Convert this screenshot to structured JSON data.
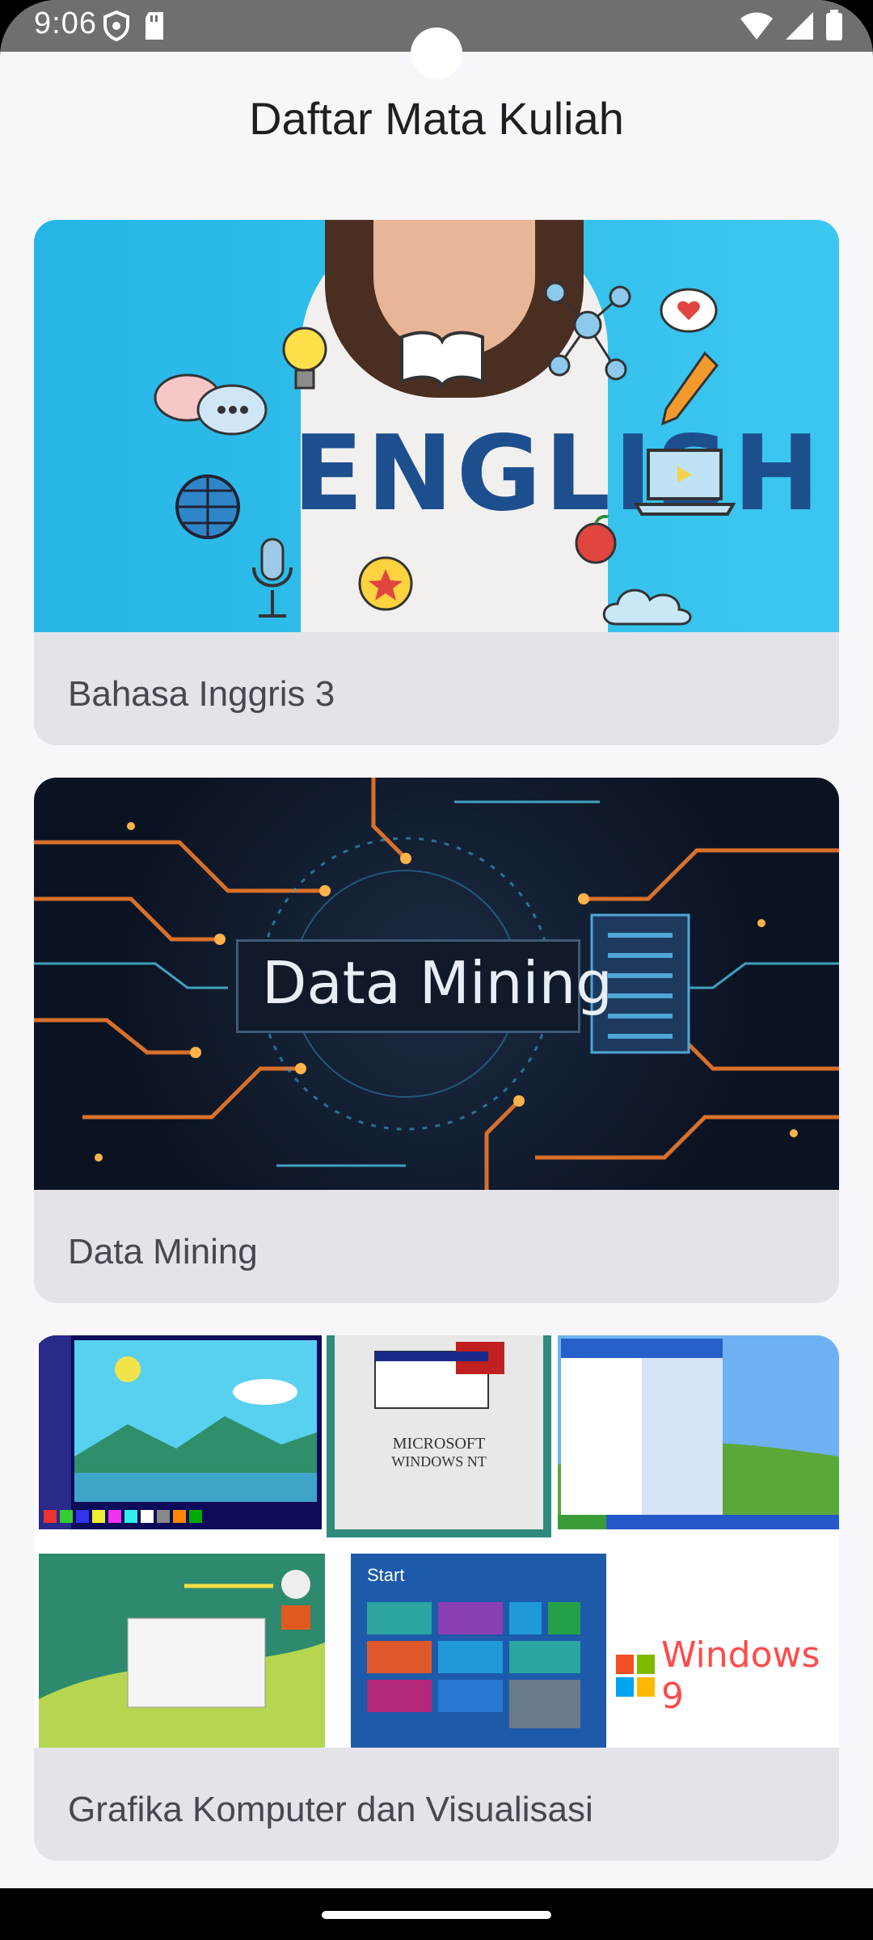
{
  "status_bar": {
    "time": "9:06"
  },
  "app_bar": {
    "title": "Daftar Mata Kuliah"
  },
  "courses": [
    {
      "name": "Bahasa Inggris 3",
      "image_text": "ENGLISH"
    },
    {
      "name": "Data Mining",
      "image_text": "Data Mining"
    },
    {
      "name": "Grafika Komputer dan Visualisasi",
      "image_text": "Windows 9"
    }
  ],
  "colors": {
    "background": "#f7f6fb",
    "card": "#e4e3ea",
    "title_text": "#1f1f23",
    "label_text": "#48474f",
    "status_bar": "#6f6f72"
  }
}
